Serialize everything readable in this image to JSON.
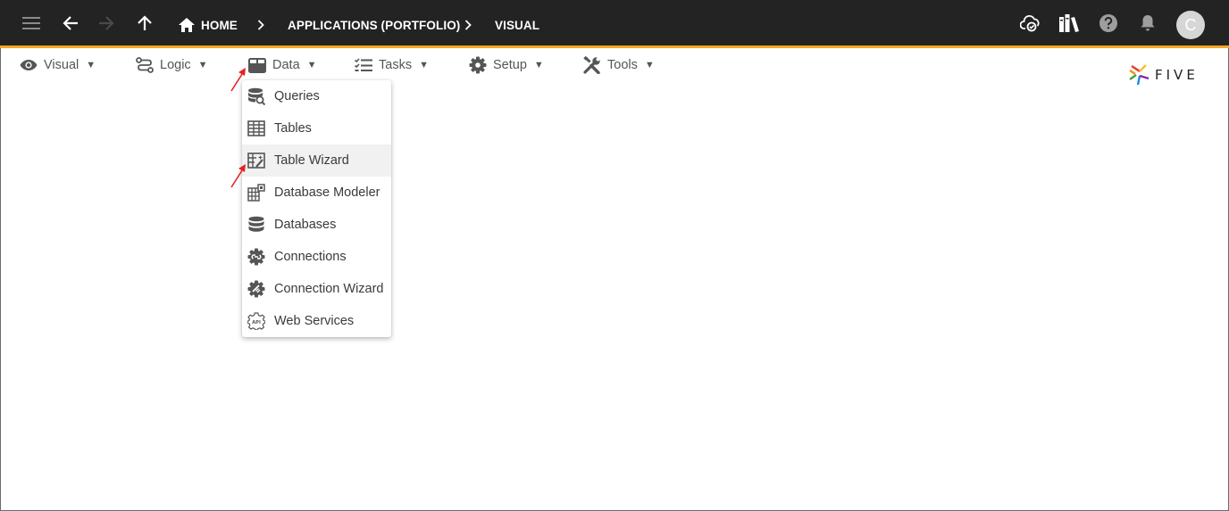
{
  "appbar": {
    "breadcrumbs": [
      {
        "label": "HOME",
        "icon": "home-icon"
      },
      {
        "label": "APPLICATIONS (PORTFOLIO)"
      },
      {
        "label": "VISUAL"
      }
    ],
    "avatar_initial": "C",
    "right_icons": [
      "cloud-sync-icon",
      "library-icon",
      "help-icon",
      "notifications-icon"
    ],
    "accent_color": "#f5a623",
    "background_color": "#232323"
  },
  "menu": {
    "items": [
      {
        "label": "Visual",
        "icon": "eye-icon"
      },
      {
        "label": "Logic",
        "icon": "flow-icon"
      },
      {
        "label": "Data",
        "icon": "table-grid-icon"
      },
      {
        "label": "Tasks",
        "icon": "checklist-icon"
      },
      {
        "label": "Setup",
        "icon": "gear-icon"
      },
      {
        "label": "Tools",
        "icon": "tools-icon"
      }
    ],
    "caret": "▼"
  },
  "dropdown": {
    "items": [
      {
        "label": "Queries",
        "icon": "database-search-icon"
      },
      {
        "label": "Tables",
        "icon": "table-icon"
      },
      {
        "label": "Table Wizard",
        "icon": "table-wizard-icon",
        "highlighted": true
      },
      {
        "label": "Database Modeler",
        "icon": "database-modeler-icon"
      },
      {
        "label": "Databases",
        "icon": "database-icon"
      },
      {
        "label": "Connections",
        "icon": "connection-gear-icon"
      },
      {
        "label": "Connection Wizard",
        "icon": "connection-wizard-icon"
      },
      {
        "label": "Web Services",
        "icon": "api-gear-icon"
      }
    ]
  },
  "logo": {
    "text": "FIVE"
  }
}
